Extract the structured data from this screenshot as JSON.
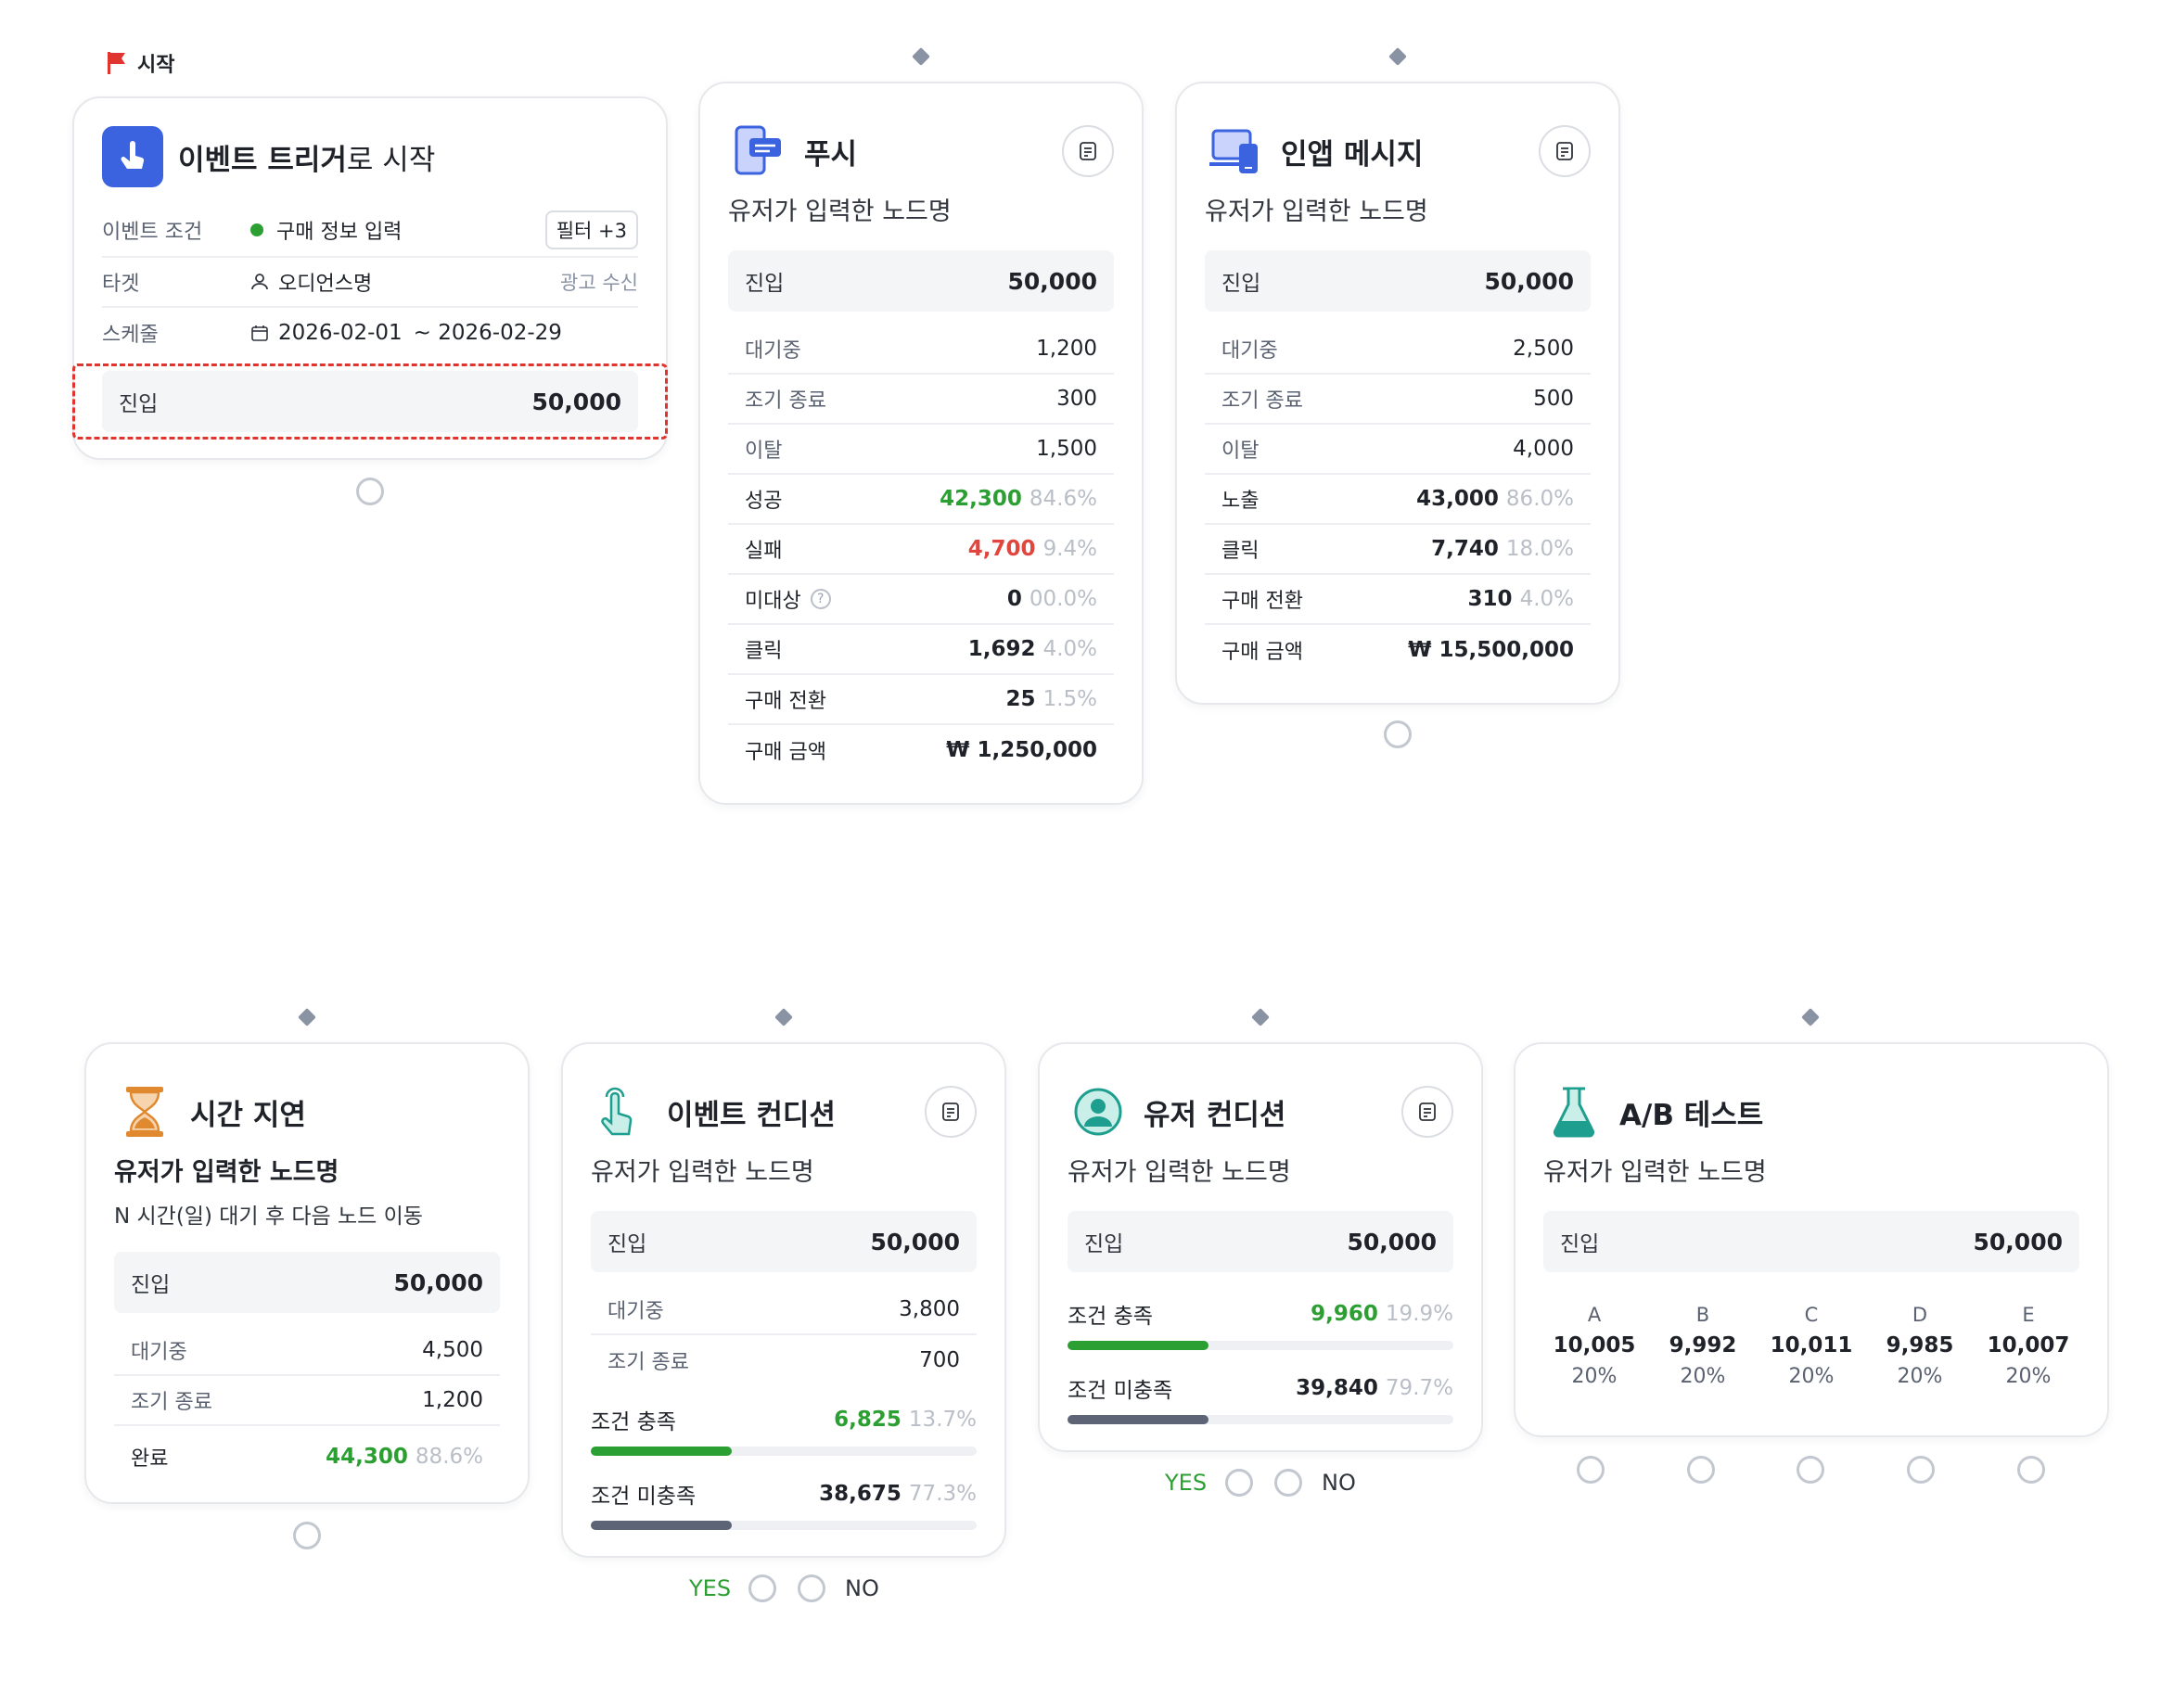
{
  "start_label": "시작",
  "colors": {
    "accent": "#3b63e0",
    "success": "#2c9f33",
    "danger": "#e0463d",
    "muted": "#b9bec7",
    "bar_neutral": "#5d6475",
    "highlight": "#e0342f"
  },
  "trigger": {
    "title_bold": "이벤트 트리거",
    "title_rest": "로 시작",
    "event_label": "이벤트 조건",
    "event_value": "구매 정보 입력",
    "filter_badge": "필터 +3",
    "target_label": "타겟",
    "target_value": "오디언스명",
    "target_extra": "광고 수신",
    "schedule_label": "스케줄",
    "schedule_start": "2026-02-01",
    "schedule_end": "~ 2026-02-29",
    "entry_label": "진입",
    "entry_value": "50,000"
  },
  "push": {
    "title": "푸시",
    "node_name": "유저가 입력한 노드명",
    "entry_label": "진입",
    "entry_value": "50,000",
    "rows": [
      {
        "label": "대기중",
        "value": "1,200"
      },
      {
        "label": "조기 종료",
        "value": "300"
      },
      {
        "label": "이탈",
        "value": "1,500"
      },
      {
        "label": "성공",
        "value": "42,300",
        "pct": "84.6%"
      },
      {
        "label": "실패",
        "value": "4,700",
        "pct": "9.4%"
      },
      {
        "label": "미대상",
        "value": "0",
        "pct": "00.0%"
      },
      {
        "label": "클릭",
        "value": "1,692",
        "pct": "4.0%"
      },
      {
        "label": "구매 전환",
        "value": "25",
        "pct": "1.5%"
      },
      {
        "label": "구매 금액",
        "value": "₩ 1,250,000"
      }
    ]
  },
  "inapp": {
    "title": "인앱 메시지",
    "node_name": "유저가 입력한 노드명",
    "entry_label": "진입",
    "entry_value": "50,000",
    "rows": [
      {
        "label": "대기중",
        "value": "2,500"
      },
      {
        "label": "조기 종료",
        "value": "500"
      },
      {
        "label": "이탈",
        "value": "4,000"
      },
      {
        "label": "노출",
        "value": "43,000",
        "pct": "86.0%"
      },
      {
        "label": "클릭",
        "value": "7,740",
        "pct": "18.0%"
      },
      {
        "label": "구매 전환",
        "value": "310",
        "pct": "4.0%"
      },
      {
        "label": "구매 금액",
        "value": "₩ 15,500,000"
      }
    ]
  },
  "delay": {
    "title": "시간 지연",
    "node_name": "유저가 입력한 노드명",
    "desc": "N 시간(일) 대기 후 다음 노드 이동",
    "entry_label": "진입",
    "entry_value": "50,000",
    "rows": [
      {
        "label": "대기중",
        "value": "4,500"
      },
      {
        "label": "조기 종료",
        "value": "1,200"
      },
      {
        "label": "완료",
        "value": "44,300",
        "pct": "88.6%"
      }
    ]
  },
  "event_cond": {
    "title": "이벤트 컨디션",
    "node_name": "유저가 입력한 노드명",
    "entry_label": "진입",
    "entry_value": "50,000",
    "rows": [
      {
        "label": "대기중",
        "value": "3,800"
      },
      {
        "label": "조기 종료",
        "value": "700"
      }
    ],
    "met_label": "조건 충족",
    "met_value": "6,825",
    "met_pct": "13.7%",
    "met_fill": 0.365,
    "unmet_label": "조건 미충족",
    "unmet_value": "38,675",
    "unmet_pct": "77.3%",
    "unmet_fill": 0.365,
    "yes": "YES",
    "no": "NO"
  },
  "user_cond": {
    "title": "유저 컨디션",
    "node_name": "유저가 입력한 노드명",
    "entry_label": "진입",
    "entry_value": "50,000",
    "met_label": "조건 충족",
    "met_value": "9,960",
    "met_pct": "19.9%",
    "met_fill": 0.365,
    "unmet_label": "조건 미충족",
    "unmet_value": "39,840",
    "unmet_pct": "79.7%",
    "unmet_fill": 0.365,
    "yes": "YES",
    "no": "NO"
  },
  "ab": {
    "title": "A/B 테스트",
    "node_name": "유저가 입력한 노드명",
    "entry_label": "진입",
    "entry_value": "50,000",
    "variants": [
      {
        "key": "A",
        "value": "10,005",
        "pct": "20%"
      },
      {
        "key": "B",
        "value": "9,992",
        "pct": "20%"
      },
      {
        "key": "C",
        "value": "10,011",
        "pct": "20%"
      },
      {
        "key": "D",
        "value": "9,985",
        "pct": "20%"
      },
      {
        "key": "E",
        "value": "10,007",
        "pct": "20%"
      }
    ]
  }
}
